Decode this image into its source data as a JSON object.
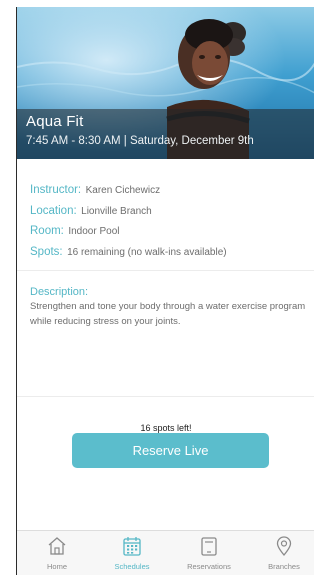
{
  "class": {
    "title": "Aqua Fit",
    "subtitle": "7:45 AM - 8:30 AM | Saturday, December 9th"
  },
  "details": {
    "instructor": {
      "label": "Instructor:",
      "value": "Karen Cichewicz"
    },
    "location": {
      "label": "Location:",
      "value": "Lionville Branch"
    },
    "room": {
      "label": "Room:",
      "value": "Indoor Pool"
    },
    "spots": {
      "label": "Spots:",
      "value": "16 remaining (no walk-ins available)"
    }
  },
  "description": {
    "label": "Description:",
    "text": "Strengthen and tone your body through a water exercise program while reducing stress on your joints."
  },
  "reserve": {
    "spots_left": "16 spots left!",
    "button_label": "Reserve Live"
  },
  "tabbar": {
    "active": "Schedules",
    "items": [
      {
        "label": "Home",
        "icon": "home-icon"
      },
      {
        "label": "Schedules",
        "icon": "calendar-icon"
      },
      {
        "label": "Reservations",
        "icon": "tablet-icon"
      },
      {
        "label": "Branches",
        "icon": "map-pin-icon"
      }
    ]
  },
  "colors": {
    "accent": "#55b7c6",
    "button": "#5bbdcc",
    "text_muted": "#6d6d6d"
  }
}
